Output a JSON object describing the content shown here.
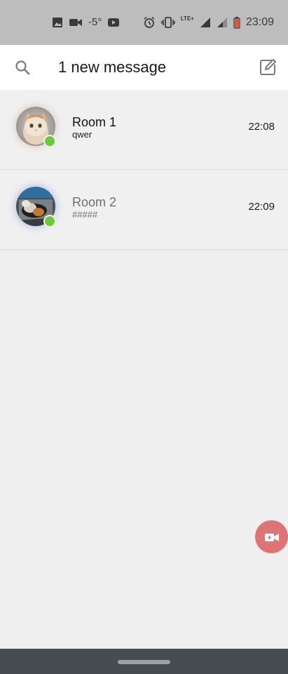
{
  "status_bar": {
    "temperature": "-5°",
    "lte_label": "LTE+",
    "time": "23:09",
    "left_icons": [
      "image-icon",
      "video-camera-icon",
      "youtube-icon"
    ],
    "right_icons": [
      "alarm-icon",
      "vibrate-icon",
      "signal-icon",
      "battery-low-icon"
    ]
  },
  "header": {
    "title": "1 new message",
    "search_icon": "search-icon",
    "compose_icon": "compose-icon"
  },
  "rooms": [
    {
      "name": "Room 1",
      "preview": "qwer",
      "time": "22:08",
      "online": true,
      "unread": true
    },
    {
      "name": "Room 2",
      "preview": "#####",
      "time": "22:09",
      "online": true,
      "unread": false
    }
  ],
  "fab": {
    "icon": "video-call-icon",
    "color": "#de7476"
  },
  "colors": {
    "online": "#6cc93a",
    "header_bg": "#ffffff",
    "list_bg": "#f0f0f0",
    "status_bar_bg": "#bdbdbd",
    "nav_bar_bg": "#474c50"
  }
}
